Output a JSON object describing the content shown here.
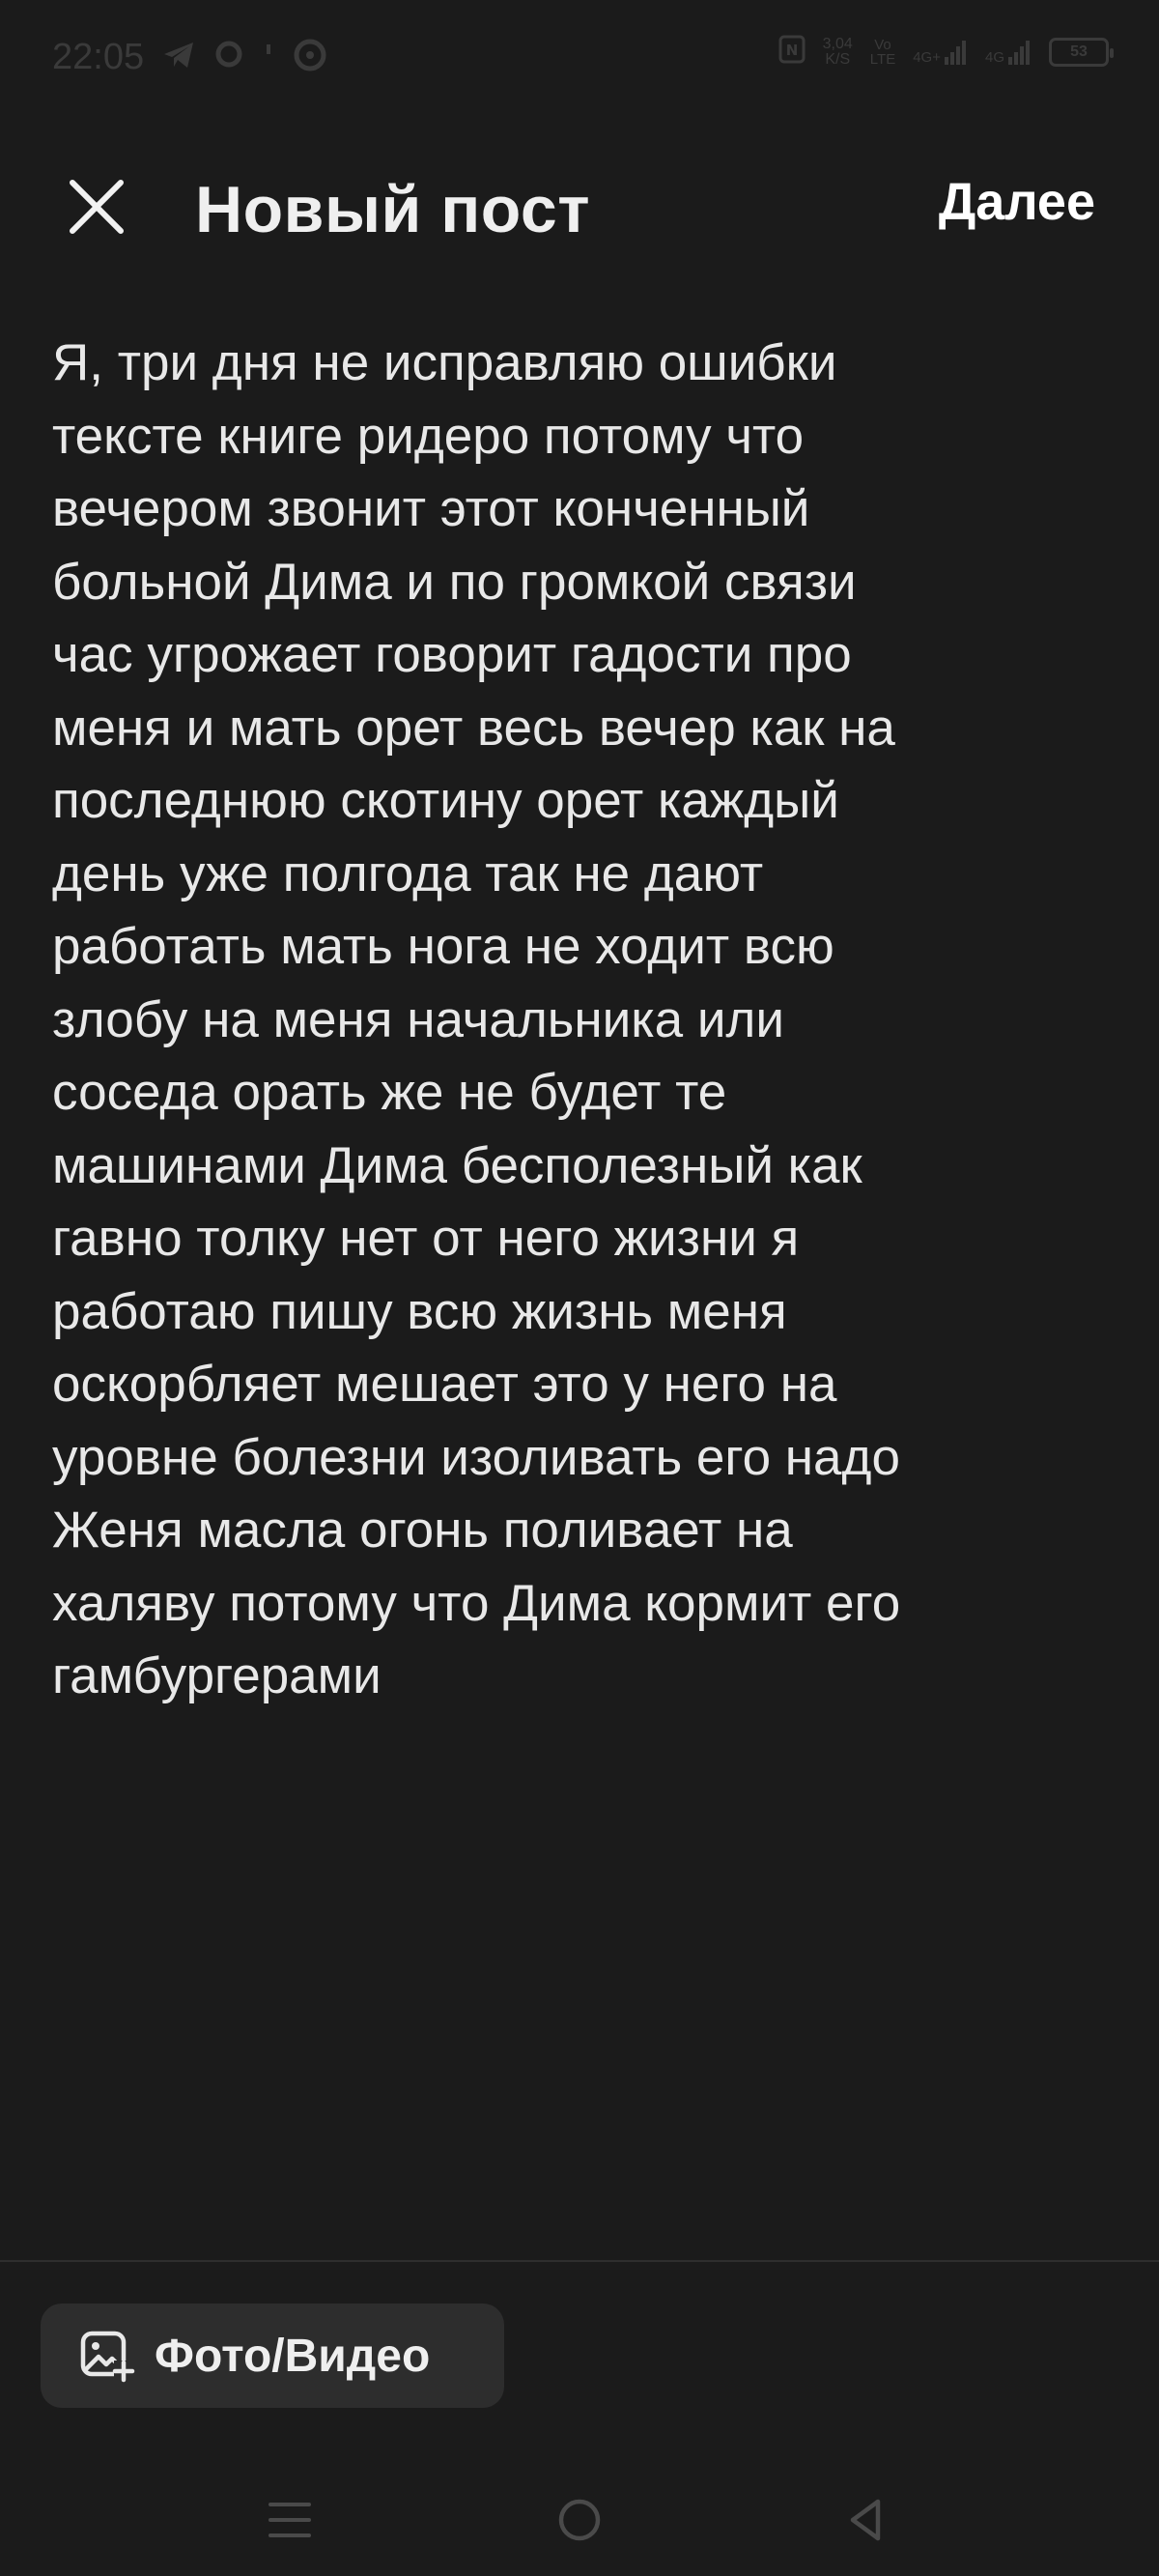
{
  "status_bar": {
    "time": "22:05",
    "net_speed_value": "3,04",
    "net_speed_unit": "K/S",
    "sim1_label": "Vo",
    "sim1_tech": "LTE",
    "sim1_gen": "4G+",
    "sim2_gen": "4G",
    "battery_level": "53"
  },
  "header": {
    "title": "Новый пост",
    "next_label": "Далее"
  },
  "post": {
    "text": "Я, три дня не исправляю ошибки\nтексте книге ридеро потому что\nвечером звонит этот конченный\nбольной Дима и по громкой связи\nчас угрожает говорит гадости про\nменя и мать орет весь вечер как на\nпоследнюю скотину орет каждый\nдень уже полгода так не дают\nработать мать нога не ходит всю\nзлобу на меня начальника или\nсоседа орать же не будет те\nмашинами Дима бесполезный как\nгавно толку нет от него жизни я\nработаю пишу всю жизнь меня\nоскорбляет мешает это у него на\nуровне болезни изоливать его надо\nЖеня масла огонь поливает на\nхаляву потому что Дима кормит его\nгамбургерами"
  },
  "toolbar": {
    "media_label": "Фото/Видео"
  },
  "icons": {
    "close": "close-icon",
    "media": "add-photo-icon",
    "nav_menu": "menu-icon",
    "nav_home": "home-circle-icon",
    "nav_back": "back-triangle-icon"
  }
}
